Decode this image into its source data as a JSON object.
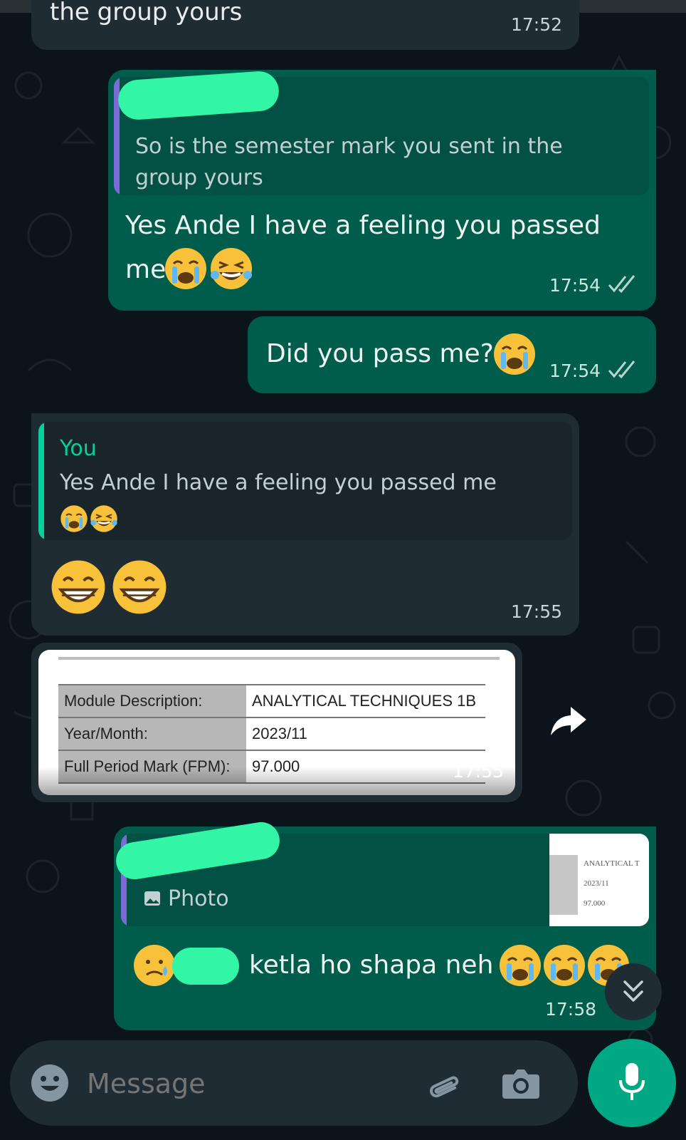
{
  "messages": {
    "m1": {
      "tail_text": "the group yours",
      "time": "17:52"
    },
    "m2": {
      "quote_text": "So is the semester mark you sent in the group yours",
      "text": "Yes Ande I have a feeling you passed me",
      "time": "17:54"
    },
    "m3": {
      "text": "Did you pass me?",
      "time": "17:54"
    },
    "m4": {
      "quote_author": "You",
      "quote_text": "Yes Ande I have a feeling you passed me",
      "time": "17:55"
    },
    "m5": {
      "rows": [
        {
          "label": "Module Description:",
          "value": "ANALYTICAL TECHNIQUES 1B"
        },
        {
          "label": "Year/Month:",
          "value": "2023/11"
        },
        {
          "label": "Full Period Mark (FPM):",
          "value": "97.000"
        }
      ],
      "time": "17:55"
    },
    "m6": {
      "quote_label": "Photo",
      "thumb_lines": [
        "ANALYTICAL T",
        "2023/11",
        "97.000"
      ],
      "text": "ketla ho shapa neh",
      "time": "17:58"
    }
  },
  "input": {
    "placeholder": "Message"
  },
  "icons": [
    "emoji-icon",
    "attach-icon",
    "camera-icon",
    "mic-icon",
    "forward-icon",
    "scroll-down-icon",
    "read-ticks-icon",
    "photo-icon"
  ],
  "colors": {
    "background": "#0b141a",
    "incoming": "#202c33",
    "outgoing": "#005c4b",
    "accent": "#00a884",
    "redaction": "#33f5a6"
  }
}
